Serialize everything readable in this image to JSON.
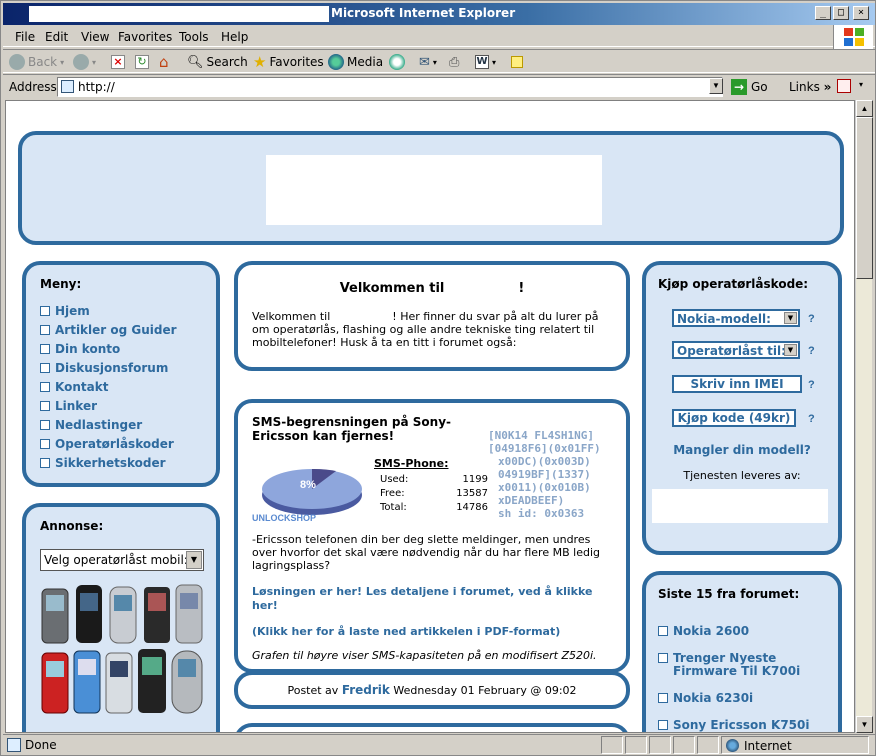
{
  "window": {
    "title": "Microsoft Internet Explorer",
    "min_label": "_",
    "max_label": "□",
    "close_label": "×"
  },
  "menu": [
    "File",
    "Edit",
    "View",
    "Favorites",
    "Tools",
    "Help"
  ],
  "toolbar": {
    "back": "Back",
    "search": "Search",
    "favorites": "Favorites",
    "media": "Media"
  },
  "address": {
    "label": "Address",
    "url": "http://",
    "go": "Go",
    "links": "Links"
  },
  "page": {
    "menu": {
      "title": "Meny:",
      "items": [
        "Hjem",
        "Artikler og Guider",
        "Din konto",
        "Diskusjonsforum",
        "Kontakt",
        "Linker",
        "Nedlastinger",
        "Operatørlåskoder",
        "Sikkerhetskoder"
      ]
    },
    "ad": {
      "title": "Annonse:",
      "select": "Velg operatørlåst mobil:"
    },
    "welcome": {
      "title_pre": "Velkommen til",
      "title_post": "!",
      "text_a": "Velkommen til",
      "text_b": "! Her finner du svar på alt du lurer på om operatørlås, flashing og alle andre tekniske ting relatert til mobiltelefoner! Husk å ta en titt i forumet også:"
    },
    "article": {
      "title": "SMS-begrensningen på Sony-Ericsson kan fjernes!",
      "code_lines": [
        "[N0K14 FL4SH1NG]",
        "[04918F6](0x01FF)",
        "x00DC)(0x003D)",
        "04919BF](1337)",
        "x0011)(0x010B)",
        "xDEADBEEF)",
        "sh id: 0x0363"
      ],
      "pie_label": "8%",
      "pie_logo": "UNLOCKSHOP",
      "sms_title": "SMS-Phone:",
      "sms_rows": [
        {
          "label": "Used:",
          "value": "1199"
        },
        {
          "label": "Free:",
          "value": "13587"
        },
        {
          "label": "Total:",
          "value": "14786"
        }
      ],
      "body": "-Ericsson telefonen din ber deg slette meldinger, men undres over hvorfor det skal være nødvendig når du har flere MB ledig lagringsplass?",
      "link1": "Løsningen er her! Les detaljene i forumet, ved å klikke her!",
      "link2": "(Klikk her for å laste ned artikkelen i PDF-format)",
      "caption": "Grafen til høyre viser SMS-kapasiteten på en modifisert Z520i.",
      "posted_pre": "Postet av",
      "author": "Fredrik",
      "posted_date": "Wednesday 01 February @ 09:02"
    },
    "buy": {
      "title": "Kjøp operatørlåskode:",
      "model_select": "Nokia-modell:",
      "operator_select": "Operatørlåst til:",
      "imei_button": "Skriv inn IMEI",
      "buy_button": "Kjøp kode (49kr)",
      "q": "?",
      "missing": "Mangler din modell?",
      "provided": "Tjenesten leveres av:"
    },
    "forum": {
      "title": "Siste 15 fra forumet:",
      "items": [
        "Nokia 2600",
        "Trenger Nyeste Firmware Til K700i",
        "Nokia 6230i",
        "Sony Ericsson K750i"
      ]
    }
  },
  "status": {
    "done": "Done",
    "zone": "Internet"
  }
}
